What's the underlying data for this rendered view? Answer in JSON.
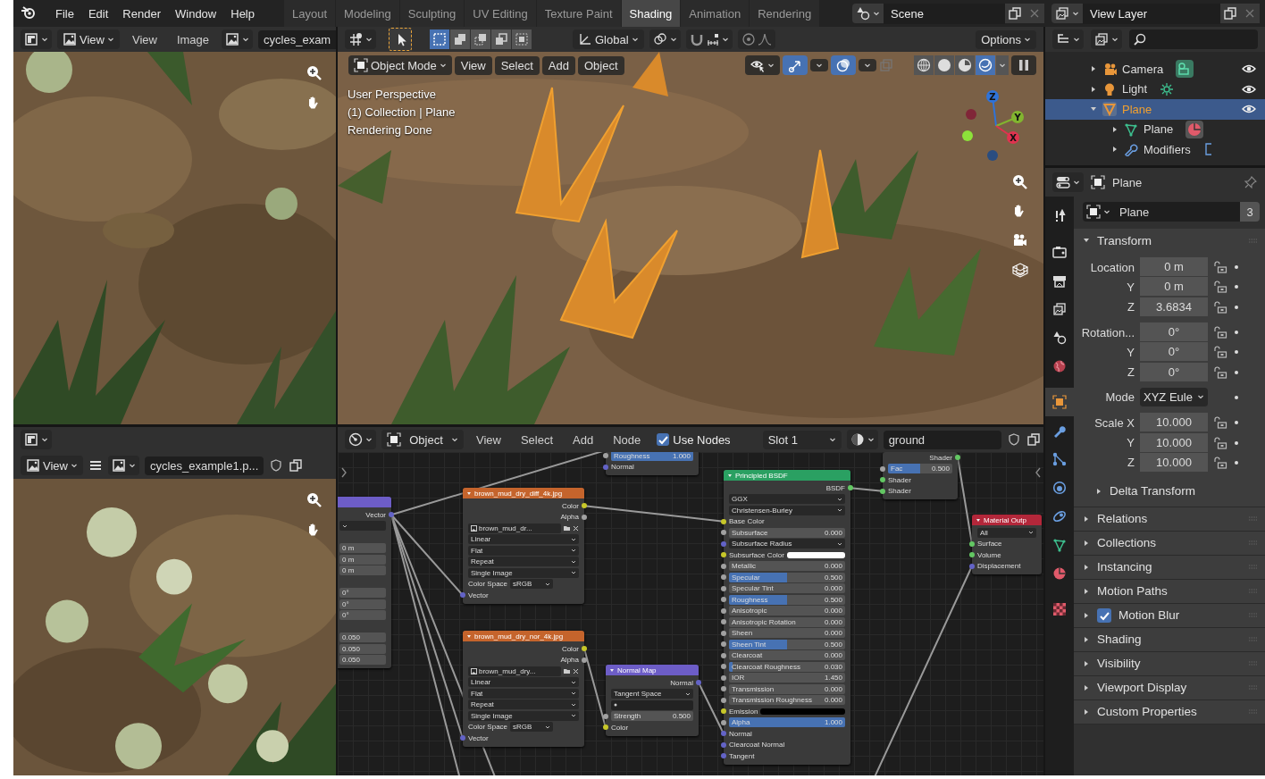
{
  "topbar": {
    "menus": [
      "File",
      "Edit",
      "Render",
      "Window",
      "Help"
    ],
    "workspaces": [
      {
        "label": "Layout",
        "selected": false
      },
      {
        "label": "Modeling",
        "selected": false
      },
      {
        "label": "Sculpting",
        "selected": false
      },
      {
        "label": "UV Editing",
        "selected": false
      },
      {
        "label": "Texture Paint",
        "selected": false
      },
      {
        "label": "Shading",
        "selected": true
      },
      {
        "label": "Animation",
        "selected": false
      },
      {
        "label": "Rendering",
        "selected": false
      }
    ],
    "scene": "Scene",
    "view_layer": "View Layer"
  },
  "image_editor_top": {
    "view_dropdown": "View",
    "menus": [
      "View",
      "Image"
    ],
    "image_name": "cycles_exam"
  },
  "image_editor_bottom": {
    "view_dropdown": "View",
    "image_name": "cycles_example1.p..."
  },
  "viewport": {
    "orientation": "Global",
    "options": "Options",
    "select_modes": [
      {
        "selected": true
      },
      {
        "selected": false
      },
      {
        "selected": false
      },
      {
        "selected": false
      },
      {
        "selected": false
      }
    ],
    "mode": "Object Mode",
    "menus": [
      "View",
      "Select",
      "Add",
      "Object"
    ],
    "show_gizmos": true,
    "show_overlays": true,
    "shading_modes": [
      {
        "selected": false
      },
      {
        "selected": false
      },
      {
        "selected": false
      },
      {
        "selected": true
      }
    ],
    "info": [
      "User Perspective",
      "(1) Collection | Plane",
      "Rendering Done"
    ],
    "gizmo_axes": [
      {
        "label": "Z",
        "color": "#2f73d9"
      },
      {
        "label": "Y",
        "color": "#82b52f"
      },
      {
        "label": "X",
        "color": "#e0334f"
      }
    ]
  },
  "node_editor": {
    "object_dropdown": "Object",
    "menus": [
      "View",
      "Select",
      "Add",
      "Node"
    ],
    "use_nodes": {
      "label": "Use Nodes",
      "checked": true
    },
    "slot": "Slot 1",
    "material": "ground",
    "nodes": [
      {
        "color": "#6d5dc7",
        "rows": [
          {
            "kind": "output",
            "label": "Vector",
            "socket": {
              "color": "#6363c7"
            }
          },
          {
            "kind": "dropdown"
          },
          {
            "kind": "gap"
          },
          {
            "kind": "field",
            "value": "0 m"
          },
          {
            "kind": "field",
            "value": "0 m"
          },
          {
            "kind": "field",
            "value": "0 m"
          },
          {
            "kind": "gap"
          },
          {
            "kind": "field",
            "value": "0°"
          },
          {
            "kind": "field",
            "value": "0°"
          },
          {
            "kind": "field",
            "value": "0°"
          },
          {
            "kind": "gap"
          },
          {
            "kind": "field",
            "value": "0.050"
          },
          {
            "kind": "field",
            "value": "0.050"
          },
          {
            "kind": "field",
            "value": "0.050"
          }
        ]
      },
      {
        "title": "brown_mud_dry_diff_4k.jpg",
        "color": "#c5642c",
        "rows": [
          {
            "kind": "output",
            "label": "Color",
            "socket": {
              "color": "#c7c729"
            }
          },
          {
            "kind": "output",
            "label": "Alpha",
            "socket": {
              "color": "#a1a1a1"
            }
          },
          {
            "kind": "image_field",
            "label": "brown_mud_dr..."
          },
          {
            "kind": "dropdown",
            "label": "Linear"
          },
          {
            "kind": "dropdown",
            "label": "Flat"
          },
          {
            "kind": "dropdown",
            "label": "Repeat"
          },
          {
            "kind": "dropdown",
            "label": "Single Image"
          },
          {
            "kind": "labeled_dropdown",
            "label": "Color Space",
            "value": "sRGB"
          },
          {
            "kind": "input",
            "label": "Vector",
            "socket": {
              "color": "#6363c7"
            }
          }
        ]
      },
      {
        "title": "brown_mud_dry_nor_4k.jpg",
        "color": "#c5642c",
        "rows": [
          {
            "kind": "output",
            "label": "Color",
            "socket": {
              "color": "#c7c729"
            }
          },
          {
            "kind": "output",
            "label": "Alpha",
            "socket": {
              "color": "#a1a1a1"
            }
          },
          {
            "kind": "image_field",
            "label": "brown_mud_dry..."
          },
          {
            "kind": "dropdown",
            "label": "Linear"
          },
          {
            "kind": "dropdown",
            "label": "Flat"
          },
          {
            "kind": "dropdown",
            "label": "Repeat"
          },
          {
            "kind": "dropdown",
            "label": "Single Image"
          },
          {
            "kind": "labeled_dropdown",
            "label": "Color Space",
            "value": "sRGB"
          },
          {
            "kind": "input",
            "label": "Vector",
            "socket": {
              "color": "#6363c7"
            }
          }
        ]
      },
      {
        "rows": [
          {
            "kind": "slider",
            "label": "Roughness",
            "value": "1.000",
            "level": 1,
            "socket": {
              "color": "#a1a1a1"
            }
          },
          {
            "kind": "input",
            "label": "Normal",
            "socket": {
              "color": "#6363c7"
            }
          }
        ]
      },
      {
        "title": "Normal Map",
        "color": "#6d5dc7",
        "rows": [
          {
            "kind": "output",
            "label": "Normal",
            "socket": {
              "color": "#6363c7"
            }
          },
          {
            "kind": "dropdown",
            "label": "Tangent Space"
          },
          {
            "kind": "blank_field"
          },
          {
            "kind": "field",
            "label": "Strength",
            "value": "0.500",
            "socket": {
              "color": "#a1a1a1"
            }
          },
          {
            "kind": "input",
            "label": "Color",
            "socket": {
              "color": "#c7c729"
            }
          }
        ]
      },
      {
        "title": "Principled BSDF",
        "color": "#2aa062",
        "rows": [
          {
            "kind": "output",
            "label": "BSDF",
            "socket": {
              "color": "#63c763"
            }
          },
          {
            "kind": "dropdown",
            "label": "GGX"
          },
          {
            "kind": "dropdown",
            "label": "Christensen-Burley"
          },
          {
            "kind": "input",
            "label": "Base Color",
            "socket": {
              "color": "#c7c729"
            }
          },
          {
            "kind": "slider",
            "label": "Subsurface",
            "value": "0.000",
            "level": 0,
            "socket": {
              "color": "#a1a1a1"
            }
          },
          {
            "kind": "dropdown",
            "label": "Subsurface Radius",
            "socket": {
              "color": "#6363c7"
            }
          },
          {
            "kind": "swatch",
            "label": "Subsurface Color",
            "color": "#ffffff",
            "socket": {
              "color": "#c7c729"
            }
          },
          {
            "kind": "slider",
            "label": "Metallic",
            "value": "0.000",
            "level": 0,
            "socket": {
              "color": "#a1a1a1"
            }
          },
          {
            "kind": "slider",
            "label": "Specular",
            "value": "0.500",
            "level": 0.5,
            "socket": {
              "color": "#a1a1a1"
            }
          },
          {
            "kind": "slider",
            "label": "Specular Tint",
            "value": "0.000",
            "level": 0,
            "socket": {
              "color": "#a1a1a1"
            }
          },
          {
            "kind": "slider",
            "label": "Roughness",
            "value": "0.500",
            "level": 0.5,
            "socket": {
              "color": "#a1a1a1"
            }
          },
          {
            "kind": "slider",
            "label": "Anisotropic",
            "value": "0.000",
            "level": 0,
            "socket": {
              "color": "#a1a1a1"
            }
          },
          {
            "kind": "slider",
            "label": "Anisotropic Rotation",
            "value": "0.000",
            "level": 0,
            "socket": {
              "color": "#a1a1a1"
            }
          },
          {
            "kind": "slider",
            "label": "Sheen",
            "value": "0.000",
            "level": 0,
            "socket": {
              "color": "#a1a1a1"
            }
          },
          {
            "kind": "slider",
            "label": "Sheen Tint",
            "value": "0.500",
            "level": 0.5,
            "socket": {
              "color": "#a1a1a1"
            }
          },
          {
            "kind": "slider",
            "label": "Clearcoat",
            "value": "0.000",
            "level": 0,
            "socket": {
              "color": "#a1a1a1"
            }
          },
          {
            "kind": "slider",
            "label": "Clearcoat Roughness",
            "value": "0.030",
            "level": 0.03,
            "socket": {
              "color": "#a1a1a1"
            }
          },
          {
            "kind": "field",
            "label": "IOR",
            "value": "1.450",
            "socket": {
              "color": "#a1a1a1"
            }
          },
          {
            "kind": "slider",
            "label": "Transmission",
            "value": "0.000",
            "level": 0,
            "socket": {
              "color": "#a1a1a1"
            }
          },
          {
            "kind": "slider",
            "label": "Transmission Roughness",
            "value": "0.000",
            "level": 0,
            "socket": {
              "color": "#a1a1a1"
            }
          },
          {
            "kind": "swatch",
            "label": "Emission",
            "color": "#000000",
            "socket": {
              "color": "#c7c729"
            }
          },
          {
            "kind": "slider",
            "label": "Alpha",
            "value": "1.000",
            "level": 1,
            "socket": {
              "color": "#a1a1a1"
            }
          },
          {
            "kind": "input",
            "label": "Normal",
            "socket": {
              "color": "#6363c7"
            }
          },
          {
            "kind": "input",
            "label": "Clearcoat Normal",
            "socket": {
              "color": "#6363c7"
            }
          },
          {
            "kind": "input",
            "label": "Tangent",
            "socket": {
              "color": "#6363c7"
            }
          }
        ]
      },
      {
        "rows": [
          {
            "kind": "output",
            "label": "Shader",
            "socket": {
              "color": "#63c763"
            }
          },
          {
            "kind": "slider",
            "label": "Fac",
            "value": "0.500",
            "level": 0.5,
            "socket": {
              "color": "#a1a1a1"
            }
          },
          {
            "kind": "input",
            "label": "Shader",
            "socket": {
              "color": "#63c763"
            }
          },
          {
            "kind": "input",
            "label": "Shader",
            "socket": {
              "color": "#63c763"
            }
          }
        ]
      },
      {
        "title": "Material Outp",
        "color": "#b3273a",
        "rows": [
          {
            "kind": "dropdown",
            "label": "All"
          },
          {
            "kind": "input",
            "label": "Surface",
            "socket": {
              "color": "#63c763"
            }
          },
          {
            "kind": "input",
            "label": "Volume",
            "socket": {
              "color": "#63c763"
            }
          },
          {
            "kind": "input",
            "label": "Displacement",
            "socket": {
              "color": "#6363c7"
            }
          }
        ]
      }
    ]
  },
  "outliner": {
    "items": [
      {
        "label": "Camera",
        "kind": "camera",
        "selected": false,
        "visible": true,
        "expanded": false
      },
      {
        "label": "Light",
        "kind": "light",
        "selected": false,
        "visible": true,
        "expanded": false
      },
      {
        "label": "Plane",
        "kind": "mesh_object",
        "selected": true,
        "visible": true,
        "expanded": true,
        "children": [
          {
            "label": "Plane",
            "kind": "mesh_data",
            "selected": false,
            "expanded": false
          },
          {
            "label": "Modifiers",
            "kind": "modifiers",
            "selected": false,
            "expanded": false
          }
        ]
      }
    ]
  },
  "properties": {
    "header": "Plane",
    "tab_groups": [
      [
        {
          "kind": "tool",
          "selected": false
        }
      ],
      [
        {
          "kind": "render",
          "selected": false
        },
        {
          "kind": "output",
          "selected": false
        },
        {
          "kind": "view_layer",
          "selected": false
        },
        {
          "kind": "scene",
          "selected": false
        },
        {
          "kind": "world",
          "selected": false
        }
      ],
      [
        {
          "kind": "object",
          "selected": true
        },
        {
          "kind": "modifiers",
          "selected": false
        },
        {
          "kind": "particles",
          "selected": false
        },
        {
          "kind": "physics",
          "selected": false
        },
        {
          "kind": "constraints",
          "selected": false
        },
        {
          "kind": "data",
          "selected": false
        },
        {
          "kind": "material",
          "selected": false
        }
      ],
      [
        {
          "kind": "texture",
          "selected": false
        }
      ]
    ],
    "datablock": {
      "name": "Plane",
      "users": "3"
    },
    "transform": {
      "label": "Transform",
      "expanded": true,
      "groups": [
        {
          "rows": [
            {
              "kind": "value",
              "label": "Location",
              "value": "0 m"
            },
            {
              "kind": "value",
              "label": "Y",
              "value": "0 m"
            },
            {
              "kind": "value",
              "label": "Z",
              "value": "3.6834"
            }
          ]
        },
        {
          "rows": [
            {
              "kind": "value",
              "label": "Rotation...",
              "value": "0°"
            },
            {
              "kind": "value",
              "label": "Y",
              "value": "0°"
            },
            {
              "kind": "value",
              "label": "Z",
              "value": "0°"
            }
          ]
        },
        {
          "rows": [
            {
              "kind": "dropdown",
              "label": "Mode",
              "value": "XYZ Eule"
            }
          ]
        },
        {
          "rows": [
            {
              "kind": "value",
              "label": "Scale X",
              "value": "10.000"
            },
            {
              "kind": "value",
              "label": "Y",
              "value": "10.000"
            },
            {
              "kind": "value",
              "label": "Z",
              "value": "10.000"
            }
          ]
        }
      ],
      "subpanels": [
        {
          "label": "Delta Transform",
          "expanded": false
        }
      ]
    },
    "panels": [
      {
        "label": "Relations",
        "kind": "plain",
        "expanded": false
      },
      {
        "label": "Collections",
        "kind": "plain",
        "expanded": false
      },
      {
        "label": "Instancing",
        "kind": "plain",
        "expanded": false
      },
      {
        "label": "Motion Paths",
        "kind": "plain",
        "expanded": false
      },
      {
        "label": "Motion Blur",
        "kind": "checkbox",
        "checked": true,
        "expanded": false
      },
      {
        "label": "Shading",
        "kind": "plain",
        "expanded": false
      },
      {
        "label": "Visibility",
        "kind": "plain",
        "expanded": false
      },
      {
        "label": "Viewport Display",
        "kind": "plain",
        "expanded": false
      },
      {
        "label": "Custom Properties",
        "kind": "plain",
        "expanded": false
      }
    ]
  }
}
